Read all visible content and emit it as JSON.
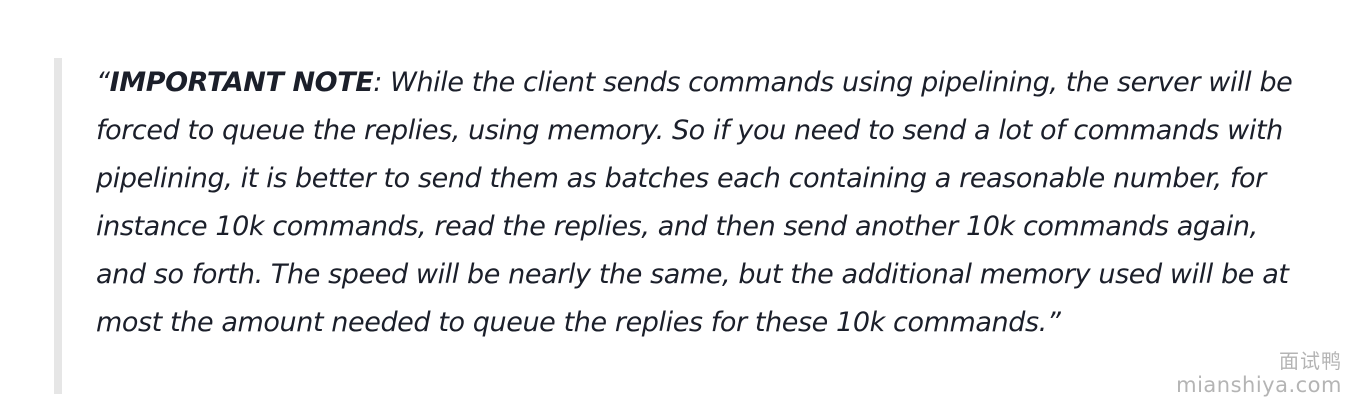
{
  "quote": {
    "open_mark": "“",
    "label": "IMPORTANT NOTE",
    "body": ": While the client sends commands using pipelining, the server will be forced to queue the replies, using memory. So if you need to send a lot of commands with pipelining, it is better to send them as batches each containing a reasonable number, for instance 10k commands, read the replies, and then send another 10k commands again, and so forth. The speed will be nearly the same, but the additional memory used will be at most the amount needed to queue the replies for these 10k commands.",
    "close_mark": "”"
  },
  "watermark": {
    "name_cn": "面试鸭",
    "url": "mianshiya.com"
  },
  "colors": {
    "text": "#1b1f2a",
    "quote_border": "#e6e6e6",
    "watermark": "#8c8c8c"
  }
}
